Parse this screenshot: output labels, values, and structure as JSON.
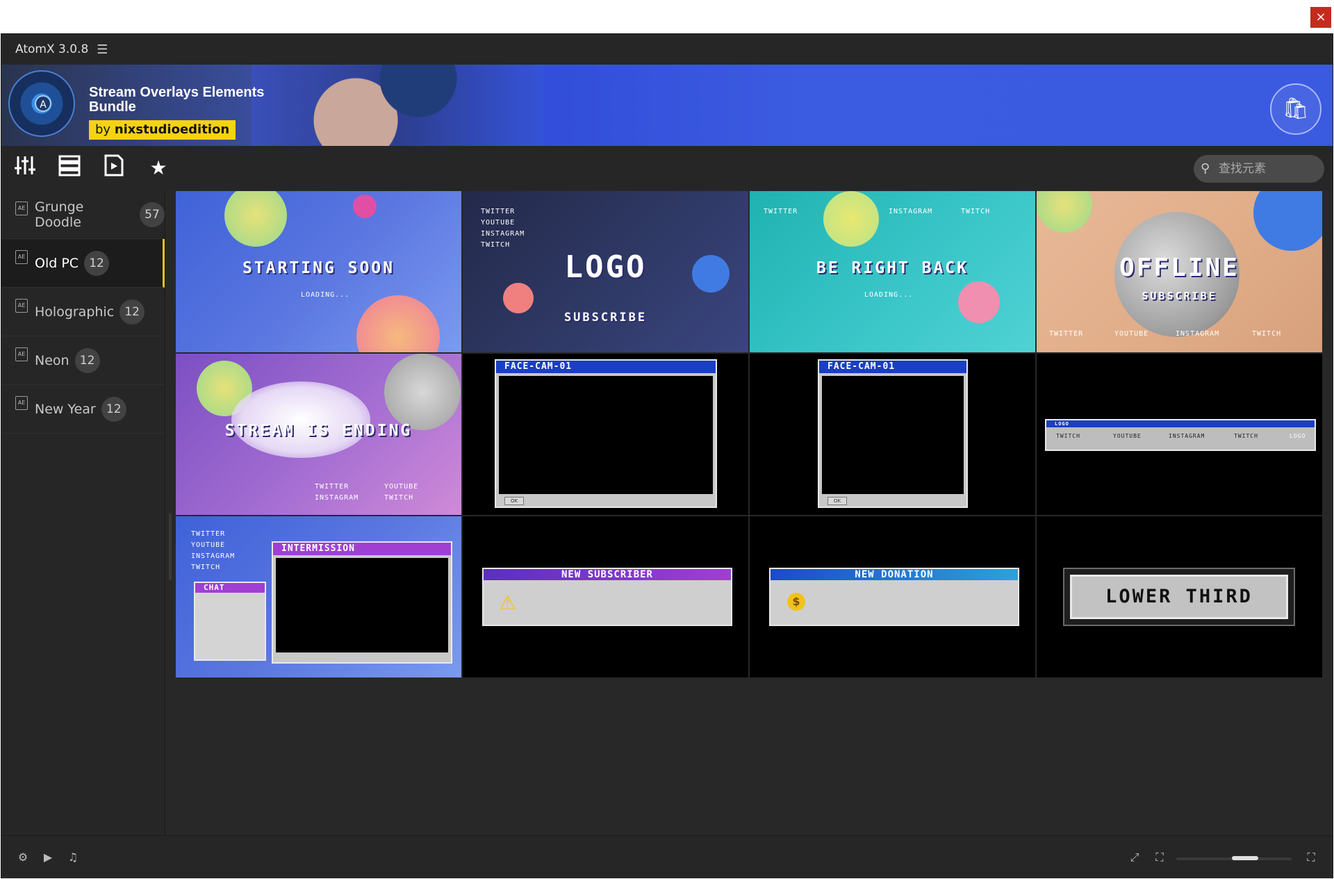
{
  "window": {
    "close_label": "×"
  },
  "app": {
    "title": "AtomX 3.0.8",
    "menu_icon": "hamburger-menu-icon"
  },
  "banner": {
    "title": "Stream Overlays Elements Bundle",
    "by": "by",
    "author": "nixstudioedition",
    "bag_icon": "shopping-bag-icon"
  },
  "toolbar": {
    "icons": [
      "sliders-icon",
      "list-icon",
      "video-file-icon",
      "star-icon"
    ],
    "search_placeholder": "查找元素"
  },
  "sidebar": {
    "items": [
      {
        "label": "Grunge Doodle",
        "count": "57",
        "active": false
      },
      {
        "label": "Old PC",
        "count": "12",
        "active": true
      },
      {
        "label": "Holographic",
        "count": "12",
        "active": false
      },
      {
        "label": "Neon",
        "count": "12",
        "active": false
      },
      {
        "label": "New Year",
        "count": "12",
        "active": false
      }
    ]
  },
  "tiles": {
    "starting_soon": "STARTING SOON",
    "loading": "LOADING...",
    "logo": "LOGO",
    "subscribe": "SUBSCRIBE",
    "be_right_back": "BE RIGHT BACK",
    "offline": "OFFLINE",
    "stream_ending": "STREAM IS ENDING",
    "facecam_1": "FACE-CAM-01",
    "facecam_2": "FACE-CAM-01",
    "intermission": "INTERMISSION",
    "chat": "CHAT",
    "new_subscriber": "NEW SUBSCRIBER",
    "new_donation": "NEW DONATION",
    "lower_third": "LOWER THIRD",
    "social": {
      "twitter": "TWITTER",
      "youtube": "YOUTUBE",
      "instagram": "INSTAGRAM",
      "twitch": "TWITCH"
    },
    "bar_logo": "LOGO",
    "ok": "OK"
  },
  "statusbar": {
    "icons_left": [
      "effects-icon",
      "video-icon",
      "music-icon"
    ],
    "icons_right": [
      "expand-icon",
      "fullscreen-icon",
      "grid-size-icon"
    ],
    "zoom_level": 0.5
  },
  "colors": {
    "accent": "#e8c21a",
    "banner_blue": "#3b5be0",
    "background": "#282828"
  }
}
